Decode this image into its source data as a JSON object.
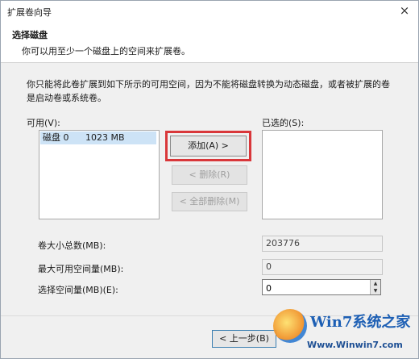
{
  "window": {
    "title": "扩展卷向导",
    "close_symbol": "×"
  },
  "header": {
    "title": "选择磁盘",
    "subtitle": "你可以用至少一个磁盘上的空间来扩展卷。"
  },
  "description": "你只能将此卷扩展到如下所示的可用空间，因为不能将磁盘转换为动态磁盘，或者被扩展的卷是启动卷或系统卷。",
  "available": {
    "label": "可用(V):",
    "items": [
      {
        "name": "磁盘 0",
        "size": "1023 MB",
        "selected": true
      }
    ]
  },
  "selected": {
    "label": "已选的(S):",
    "items": []
  },
  "buttons": {
    "add": "添加(A) >",
    "remove": "< 删除(R)",
    "remove_all": "< 全部删除(M)",
    "back": "< 上一步(B)"
  },
  "fields": {
    "total_size_label": "卷大小总数(MB):",
    "total_size_value": "203776",
    "max_available_label": "最大可用空间量(MB):",
    "max_available_value": "0",
    "select_amount_label": "选择空间量(MB)(E):",
    "select_amount_value": "0"
  },
  "watermark": {
    "brand": "Win7系统之家",
    "url": "Www.Winwin7.com"
  },
  "colors": {
    "highlight": "#d9373a",
    "selection": "#cde3f6",
    "accent": "#3c7fb1"
  }
}
